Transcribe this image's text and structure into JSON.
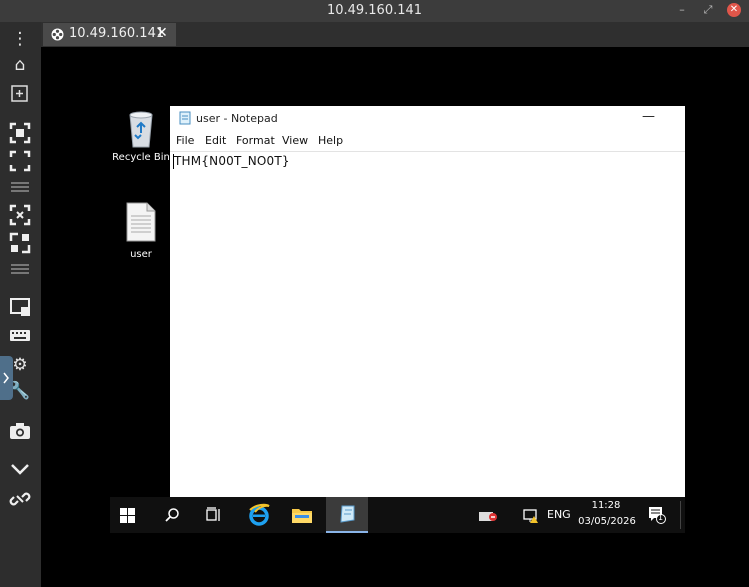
{
  "window": {
    "title": "10.49.160.141"
  },
  "tab": {
    "label": "10.49.160.141",
    "close": "✕"
  },
  "desktop": {
    "icons": [
      {
        "label": "Recycle Bin",
        "icon": "recycle-bin-icon"
      },
      {
        "label": "user",
        "icon": "text-file-icon"
      }
    ]
  },
  "notepad": {
    "title": "user - Notepad",
    "menu": [
      "File",
      "Edit",
      "Format",
      "View",
      "Help"
    ],
    "content": "THM{N00T_NO0T}"
  },
  "taskbar": {
    "language": "ENG",
    "time": "11:28",
    "date": "03/05/2026",
    "notification_count": "1"
  }
}
